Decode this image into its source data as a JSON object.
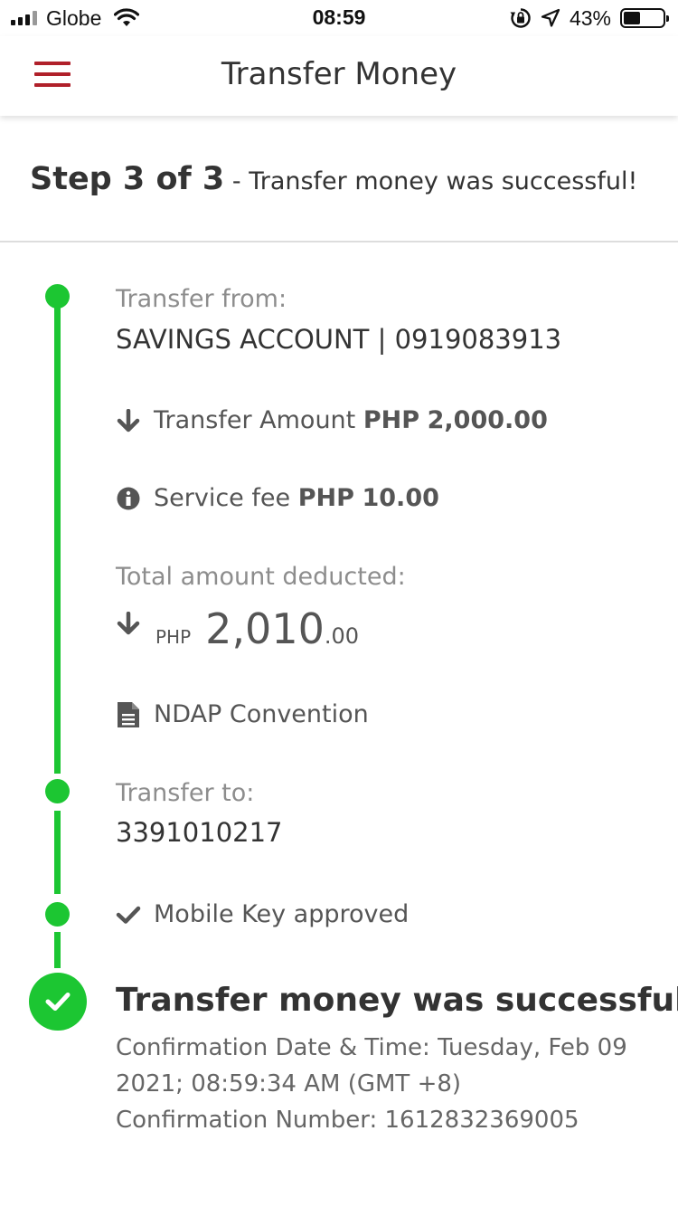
{
  "status_bar": {
    "carrier": "Globe",
    "time": "08:59",
    "battery_percent": "43%",
    "battery_level": 0.43
  },
  "header": {
    "title": "Transfer Money",
    "menu_icon": "hamburger-menu-icon",
    "accent_color": "#b0202a"
  },
  "step": {
    "label": "Step 3 of 3",
    "separator": " - ",
    "description": "Transfer money was successful!"
  },
  "timeline": {
    "color": "#1cc632",
    "transfer_from": {
      "label": "Transfer from:",
      "account": "SAVINGS ACCOUNT | 0919083913"
    },
    "transfer_amount": {
      "icon": "arrow-down-icon",
      "label": "Transfer Amount",
      "currency": "PHP",
      "value": "2,000.00"
    },
    "service_fee": {
      "icon": "info-icon",
      "label": "Service fee",
      "currency": "PHP",
      "value": "10.00"
    },
    "total_deducted": {
      "label": "Total amount deducted:",
      "icon": "arrow-down-icon",
      "currency": "PHP",
      "integer": "2,010",
      "decimal": ".00"
    },
    "remarks": {
      "icon": "document-icon",
      "text": "NDAP Convention"
    },
    "transfer_to": {
      "label": "Transfer to:",
      "account": "3391010217"
    },
    "mobile_key": {
      "icon": "checkmark-icon",
      "text": "Mobile Key approved"
    },
    "result": {
      "icon": "success-check-icon",
      "title": "Transfer money was successful!",
      "confirmation_date": "Confirmation Date & Time: Tuesday, Feb 09 2021; 08:59:34 AM (GMT +8)",
      "confirmation_number": "Confirmation Number: 1612832369005"
    }
  }
}
